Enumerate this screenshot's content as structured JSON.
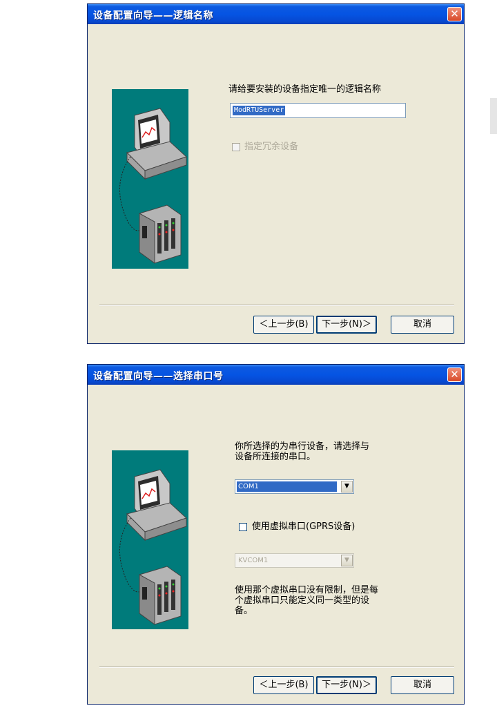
{
  "dialog1": {
    "title": "设备配置向导——逻辑名称",
    "close": "✕",
    "prompt": "请给要安装的设备指定唯一的逻辑名称",
    "logical_name_value": "ModRTUServer",
    "redundant_label": "指定冗余设备",
    "back_button": "＜上一步(B)",
    "next_button": "下一步(N)＞",
    "cancel_button": "取消"
  },
  "dialog2": {
    "title": "设备配置向导——选择串口号",
    "close": "✕",
    "prompt": "你所选择的为串行设备，请选择与\n设备所连接的串口。",
    "port_value": "COM1",
    "virtual_port_label": "使用虚拟串口(GPRS设备)",
    "virtual_port_value": "KVCOM1",
    "note": "使用那个虚拟串口没有限制，但是每\n个虚拟串口只能定义同一类型的设\n备。",
    "back_button": "＜上一步(B)",
    "next_button": "下一步(N)＞",
    "cancel_button": "取消"
  },
  "icons": {
    "dropdown_arrow": "▼",
    "illustration": "computer-plc-illustration"
  },
  "colors": {
    "title_blue": "#0554e3",
    "dialog_bg": "#ece9d8",
    "illustration_teal": "#007b7b",
    "close_red": "#d84a2a",
    "selection_blue": "#316ac5"
  }
}
